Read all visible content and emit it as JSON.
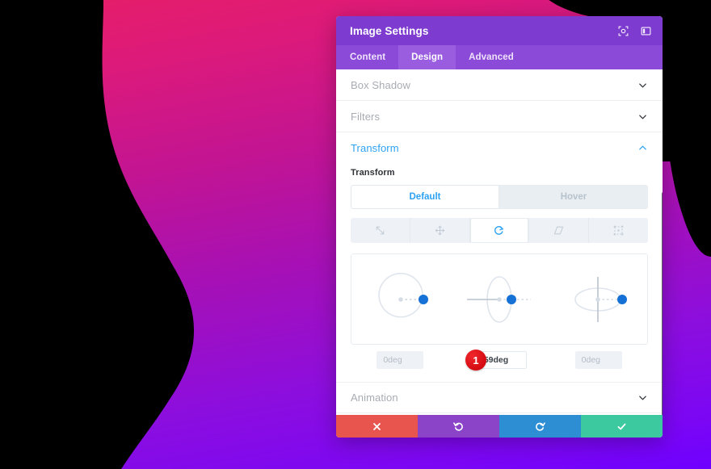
{
  "background": {
    "gradient_from": "#e61e66",
    "gradient_mid": "#a410b8",
    "gradient_to": "#6f00ff",
    "blob_color": "#000000"
  },
  "modal": {
    "title": "Image Settings",
    "header_color": "#7e3bd0",
    "tabbar_color": "#8b4ad8",
    "header_icons": [
      {
        "name": "fullscreen-icon",
        "label": "Expand"
      },
      {
        "name": "layout-toggle-icon",
        "label": "Toggle Layout"
      }
    ],
    "tabs": [
      {
        "label": "Content",
        "active": false
      },
      {
        "label": "Design",
        "active": true
      },
      {
        "label": "Advanced",
        "active": false
      }
    ],
    "sections": [
      {
        "label": "Box Shadow",
        "open": false
      },
      {
        "label": "Filters",
        "open": false
      },
      {
        "label": "Transform",
        "open": true
      },
      {
        "label": "Animation",
        "open": false
      }
    ],
    "transform": {
      "field_label": "Transform",
      "states": [
        {
          "label": "Default",
          "active": true
        },
        {
          "label": "Hover",
          "active": false
        }
      ],
      "modes": [
        {
          "name": "scale-icon",
          "label": "Scale",
          "active": false
        },
        {
          "name": "translate-icon",
          "label": "Translate",
          "active": false
        },
        {
          "name": "rotate-icon",
          "label": "Rotate",
          "active": true
        },
        {
          "name": "skew-icon",
          "label": "Skew",
          "active": false
        },
        {
          "name": "origin-icon",
          "label": "Transform Origin",
          "active": false
        }
      ],
      "dials": [
        {
          "axis": "z",
          "name": "rotate-z-dial"
        },
        {
          "axis": "y",
          "name": "rotate-y-dial"
        },
        {
          "axis": "x",
          "name": "rotate-x-dial"
        }
      ],
      "values": [
        {
          "axis": "z",
          "value": "0deg",
          "focused": false,
          "badge": null
        },
        {
          "axis": "y",
          "value": "359deg",
          "focused": true,
          "badge": "1"
        },
        {
          "axis": "x",
          "value": "0deg",
          "focused": false,
          "badge": null
        }
      ],
      "handle_color": "#1571d6",
      "track_color": "#dfe5ec"
    },
    "footer": [
      {
        "name": "cancel-button",
        "icon": "close-icon",
        "color": "#e8544e"
      },
      {
        "name": "undo-button",
        "icon": "undo-icon",
        "color": "#8b44c7"
      },
      {
        "name": "redo-button",
        "icon": "redo-icon",
        "color": "#2d8ed4"
      },
      {
        "name": "save-button",
        "icon": "check-icon",
        "color": "#3dc9a0"
      }
    ]
  }
}
